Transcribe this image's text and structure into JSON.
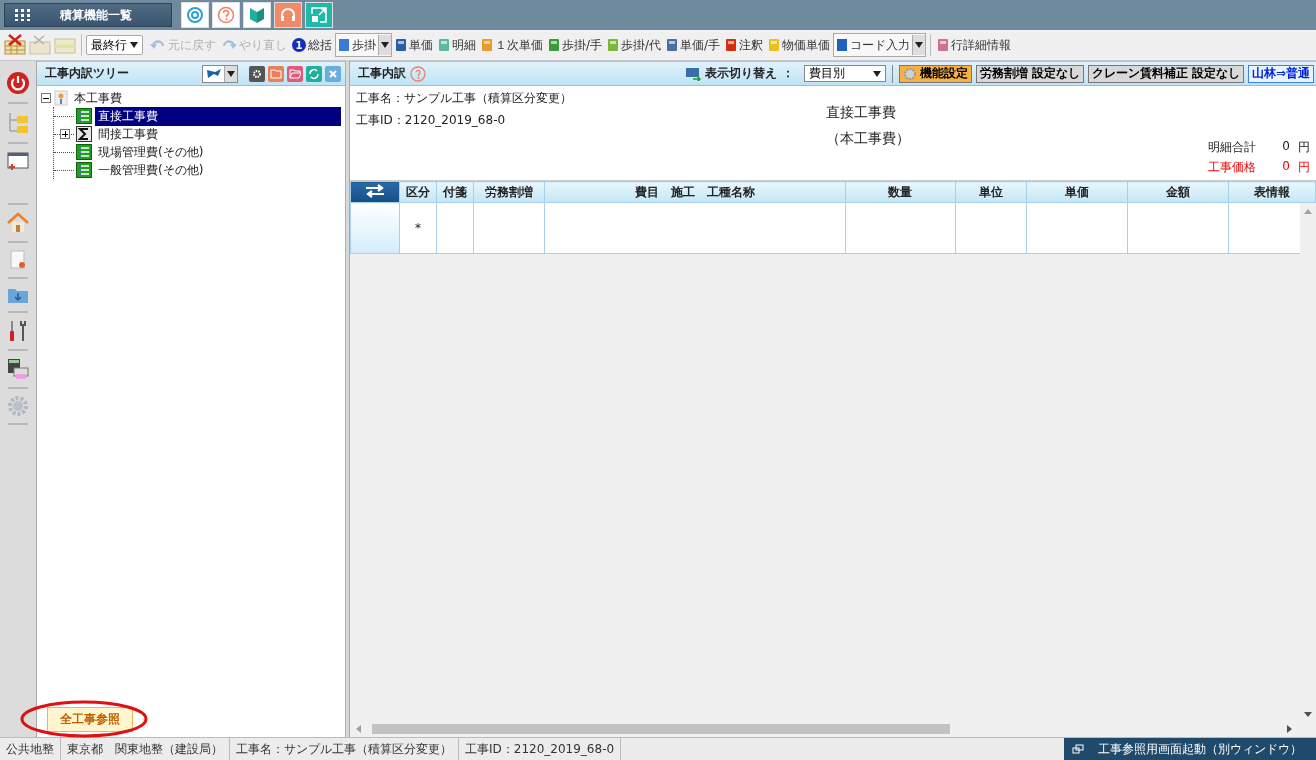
{
  "header": {
    "title": "積算機能一覧"
  },
  "toolbar": {
    "position_select": "最終行",
    "buttons": [
      {
        "label": "元に戻す",
        "kind": "plain",
        "disabled": true
      },
      {
        "label": "やり直し",
        "kind": "plain",
        "disabled": true
      },
      {
        "label": "総括",
        "kind": "numbered",
        "badge": "1",
        "disabled": false
      },
      {
        "label": "歩掛",
        "kind": "dropdown",
        "disabled": false
      },
      {
        "label": "単価",
        "kind": "plain",
        "disabled": false
      },
      {
        "label": "明細",
        "kind": "plain",
        "disabled": false
      },
      {
        "label": "１次単価",
        "kind": "plain",
        "disabled": false
      },
      {
        "label": "歩掛/手",
        "kind": "plain",
        "disabled": false
      },
      {
        "label": "歩掛/代",
        "kind": "plain",
        "disabled": false
      },
      {
        "label": "単価/手",
        "kind": "plain",
        "disabled": false
      },
      {
        "label": "注釈",
        "kind": "plain",
        "disabled": false
      },
      {
        "label": "物価単価",
        "kind": "plain",
        "disabled": false
      },
      {
        "label": "コード入力",
        "kind": "dropdown",
        "disabled": false
      },
      {
        "label": "行詳細情報",
        "kind": "plain",
        "disabled": false
      }
    ]
  },
  "tree_panel": {
    "title": "工事内訳ツリー",
    "tree": [
      {
        "label": "本工事費",
        "kind": "root",
        "selected": false,
        "expanded": true,
        "children": [
          {
            "label": "直接工事費",
            "kind": "list",
            "selected": true
          },
          {
            "label": "間接工事費",
            "kind": "sum",
            "selected": false,
            "expanded": false
          },
          {
            "label": "現場管理費(その他)",
            "kind": "list",
            "selected": false
          },
          {
            "label": "一般管理費(その他)",
            "kind": "list",
            "selected": false
          }
        ]
      }
    ],
    "bottom_button": "全工事参照"
  },
  "main_panel": {
    "title": "工事内訳",
    "display_switch_label": "表示切り替え ：",
    "display_select": "費目別",
    "buttons": [
      {
        "label": "機能設定",
        "kind": "settings"
      },
      {
        "label": "労務割増 設定なし",
        "kind": "status"
      },
      {
        "label": "クレーン賃料補正 設定なし",
        "kind": "status"
      },
      {
        "label": "山林⇒普通",
        "kind": "link"
      }
    ],
    "project_name": "工事名：サンプル工事（積算区分変更）",
    "project_id": "工事ID：2120_2019_68-0",
    "heading": "直接工事費",
    "subheading": "（本工事費）",
    "totals": [
      {
        "label": "明細合計",
        "value": "0",
        "unit": "円",
        "alert": false
      },
      {
        "label": "工事価格",
        "value": "0",
        "unit": "円",
        "alert": true
      }
    ],
    "table": {
      "columns": [
        "区分",
        "付箋",
        "労務割増",
        "費目　施工　工種名称",
        "数量",
        "単位",
        "単価",
        "金額",
        "表情報"
      ],
      "rows": [
        {
          "cells": [
            "*"
          ]
        }
      ]
    }
  },
  "status_bar": {
    "items": [
      "公共地整",
      "東京都　関東地整（建設局）",
      "工事名：サンプル工事（積算区分変更）",
      "工事ID：2120_2019_68-0"
    ],
    "launch_button": "工事参照用画面起動（別ウィンドウ）"
  }
}
